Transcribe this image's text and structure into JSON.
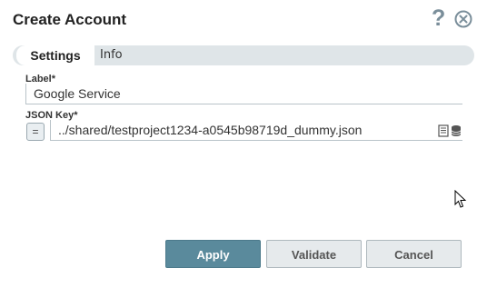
{
  "dialog": {
    "title": "Create Account",
    "help_glyph": "?"
  },
  "tabs": [
    {
      "label": "Settings",
      "active": true
    },
    {
      "label": "Info",
      "active": false
    }
  ],
  "fields": {
    "label": {
      "label": "Label*",
      "value": "Google Service"
    },
    "json_key": {
      "label": "JSON Key*",
      "value": "../shared/testproject1234-a0545b98719d_dummy.json",
      "expr_toggle": "="
    }
  },
  "buttons": {
    "apply": "Apply",
    "validate": "Validate",
    "cancel": "Cancel"
  },
  "icons": {
    "help": "help-icon",
    "close": "close-icon",
    "file_browse": "file-icon",
    "database": "database-icon",
    "cursor": "mouse-cursor-icon"
  },
  "colors": {
    "primary": "#5a8a9c",
    "tabbar": "#dfe5e8",
    "secondary_button": "#e6eaec"
  }
}
